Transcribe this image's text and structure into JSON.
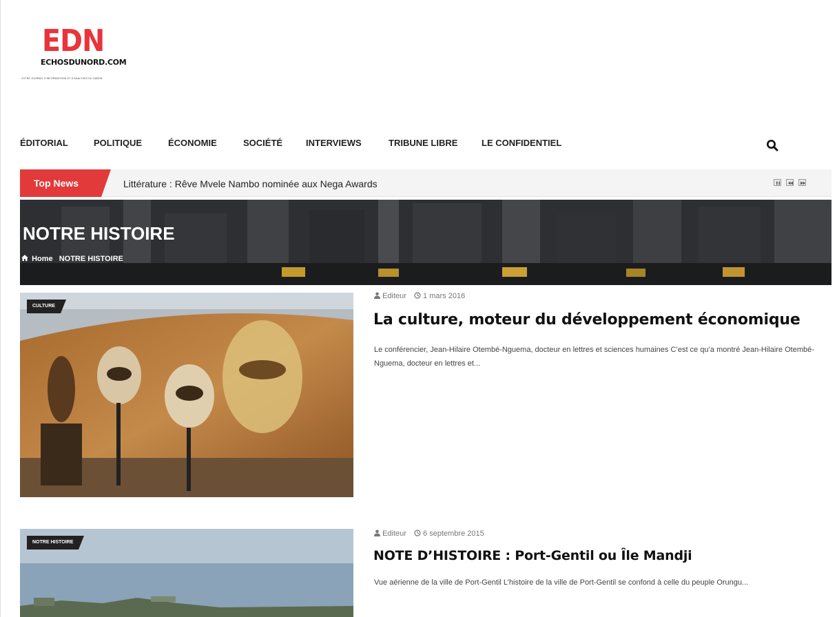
{
  "logo": {
    "brand": "EDN",
    "site": "ECHOSDUNORD.COM",
    "tagline": "VOTRE JOURNAL D'INFORMATIONS ET D'ANALYSES DU GABON"
  },
  "nav": {
    "items": [
      "ÉDITORIAL",
      "POLITIQUE",
      "ÉCONOMIE",
      "SOCIÉTÉ",
      "INTERVIEWS",
      "TRIBUNE LIBRE",
      "LE CONFIDENTIEL"
    ],
    "search_icon": "search-icon"
  },
  "ticker": {
    "label": "Top News",
    "headline": "Littérature : Rêve Mvele Nambo nominée aux Nega Awards",
    "controls": [
      "pause-icon",
      "prev-icon",
      "next-icon"
    ]
  },
  "banner": {
    "title": "NOTRE HISTOIRE",
    "breadcrumb_home": "Home",
    "breadcrumb_current": "NOTRE HISTOIRE"
  },
  "articles": [
    {
      "category": "CULTURE",
      "author": "Editeur",
      "date": "1 mars 2016",
      "title": "La culture, moteur du développement économique",
      "excerpt": "Le conférencier, Jean-Hilaire Otembé-Nguema, docteur en lettres et sciences humaines C’est ce qu’a montré Jean-Hilaire Otembé-Nguema, docteur en lettres et..."
    },
    {
      "category": "NOTRE HISTOIRE",
      "author": "Editeur",
      "date": "6 septembre 2015",
      "title": "NOTE D’HISTOIRE : Port-Gentil ou Île Mandji",
      "excerpt": "Vue aérienne de la ville de Port-Gentil L’histoire de la ville de Port-Gentil se confond à celle du peuple Orungu..."
    }
  ],
  "colors": {
    "accent_red": "#e23a3a",
    "logo_red": "#e8343a",
    "badge_dark": "#222222"
  }
}
